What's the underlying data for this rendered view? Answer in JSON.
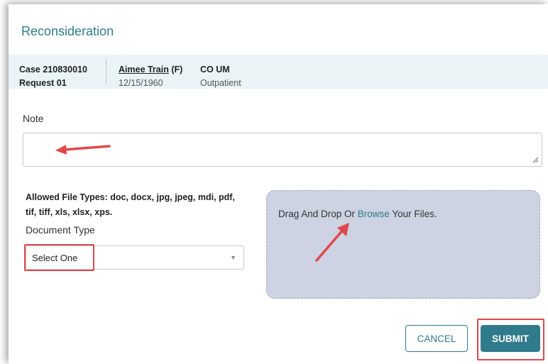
{
  "dialog": {
    "title": "Reconsideration"
  },
  "case_bar": {
    "case_label": "Case 210830010",
    "request_label": "Request 01",
    "patient_name": "Aimee Train",
    "patient_sex": " (F)",
    "patient_dob": "12/15/1960",
    "program": "CO UM",
    "setting": "Outpatient"
  },
  "note": {
    "label": "Note",
    "value": ""
  },
  "upload": {
    "allowed_types": "Allowed File Types: doc, docx, jpg, jpeg, mdi, pdf, tif, tiff, xls, xlsx, xps.",
    "document_type_label": "Document Type",
    "document_type_selected": "Select One",
    "drop_text_before": "Drag And Drop Or ",
    "browse_label": "Browse",
    "drop_text_after": " Your Files."
  },
  "actions": {
    "cancel_label": "CANCEL",
    "submit_label": "SUBMIT"
  },
  "colors": {
    "accent": "#2f7b8c",
    "annotation": "#e0474c",
    "dropzone": "#cdd3e2",
    "case_bar": "#eaf4f7"
  },
  "icons": {
    "select_caret": "chevron-down-icon",
    "resize": "resize-grip-icon"
  }
}
